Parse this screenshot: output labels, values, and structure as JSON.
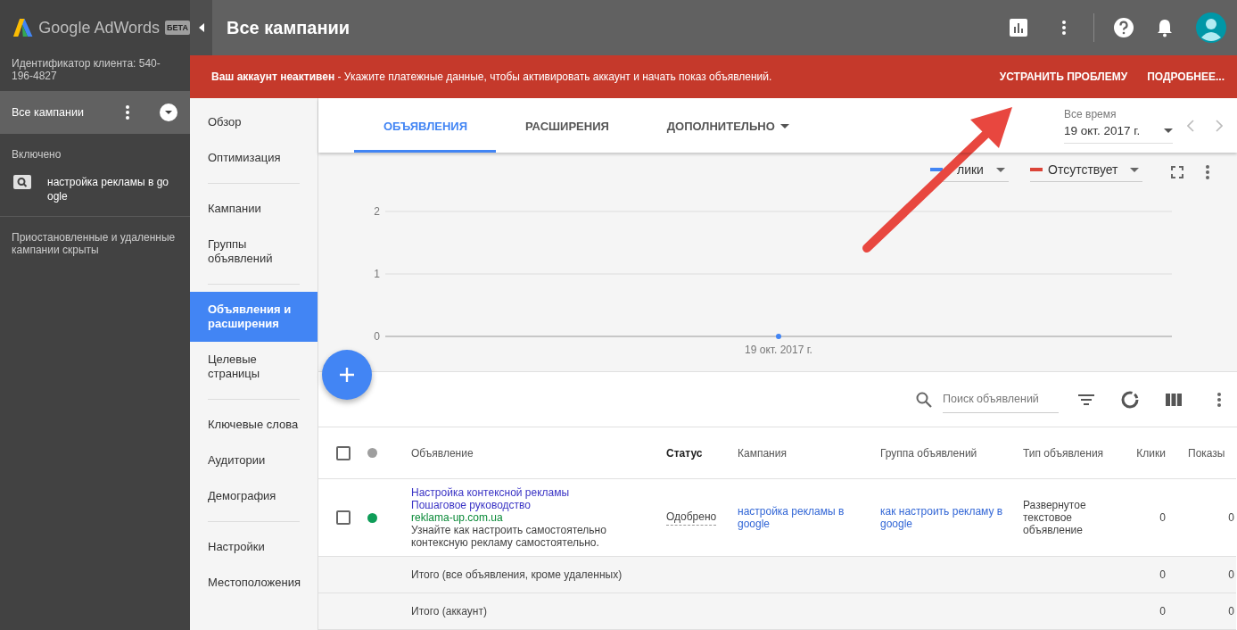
{
  "sidebar": {
    "product": "Google AdWords",
    "badge": "БЕТА",
    "client_id": "Идентификатор клиента: 540-196-4827",
    "current": {
      "label": "Все кампании",
      "selected": true
    },
    "section": "Включено",
    "campaigns": [
      {
        "label": "настройка рекламы в google"
      }
    ],
    "note": "Приостановленные и удаленные кампании скрыты"
  },
  "header": {
    "title": "Все кампании"
  },
  "banner": {
    "message": "**Ваш аккаунт неактивен** - Укажите платежные данные, чтобы активировать аккаунт и начать показ объявлений.",
    "actions": [
      "УСТРАНИТЬ ПРОБЛЕМУ",
      "ПОДРОБНЕЕ..."
    ]
  },
  "nav": {
    "groups": [
      [
        {
          "label": "Обзор",
          "selected": false
        },
        {
          "label": "Оптимизация",
          "selected": false
        }
      ],
      [
        {
          "label": "Кампании",
          "selected": false
        },
        {
          "label": "Группы объявлений",
          "selected": false
        }
      ],
      [
        {
          "label": "Объявления и расширения",
          "selected": true
        },
        {
          "label": "Целевые страницы",
          "selected": false
        }
      ],
      [
        {
          "label": "Ключевые слова",
          "selected": false
        },
        {
          "label": "Аудитории",
          "selected": false
        },
        {
          "label": "Демография",
          "selected": false
        }
      ],
      [
        {
          "label": "Настройки",
          "selected": false
        },
        {
          "label": "Местоположения",
          "selected": false
        }
      ]
    ]
  },
  "tabs": [
    {
      "label": "ОБЪЯВЛЕНИЯ",
      "selected": true,
      "has_menu": false
    },
    {
      "label": "РАСШИРЕНИЯ",
      "selected": false,
      "has_menu": false
    },
    {
      "label": "ДОПОЛНИТЕЛЬНО",
      "selected": false,
      "has_menu": true
    }
  ],
  "date_range": {
    "label": "Все время",
    "value": "19 окт. 2017 г."
  },
  "chart": {
    "metrics": [
      {
        "label": "лики",
        "color": "#4285f4"
      },
      {
        "label": "Отсутствует",
        "color": "#db4437"
      }
    ],
    "chart_data": {
      "type": "line",
      "categories": [
        "19 окт. 2017 г."
      ],
      "series": [
        {
          "color": "#4285f4",
          "marker": "circle",
          "values": [
            0
          ]
        }
      ],
      "ylim": [
        0,
        2
      ],
      "yticks": [
        0,
        1,
        2
      ]
    }
  },
  "table": {
    "search_placeholder": "Поиск объявлений",
    "header": {
      "checked": false,
      "color": "#9e9e9e"
    },
    "columns": [
      {
        "label": "Объявление",
        "sorted": false
      },
      {
        "label": "Статус",
        "sorted": true
      },
      {
        "label": "Кампания",
        "sorted": false
      },
      {
        "label": "Группа объявлений",
        "sorted": false
      },
      {
        "label": "Тип объявления",
        "sorted": false
      },
      {
        "label": "Клики",
        "sorted": false
      },
      {
        "label": "Показы",
        "sorted": false
      }
    ],
    "rows": [
      {
        "checked": false,
        "color": "#0f9d58",
        "headline1": "Настройка контексной рекламы",
        "headline2": "Пошаговое руководство",
        "url": "reklama-up.com.ua",
        "description": "Узнайте как настроить самостоятельно контексную рекламу самостоятельно.",
        "status": "Одобрено",
        "campaign": "настройка рекламы в google",
        "ad_group": "как настроить рекламу в google",
        "ad_type": "Развернутое текстовое объявление",
        "clicks": "0",
        "impressions": "0"
      }
    ],
    "totals": [
      {
        "label": "Итого (все объявления, кроме удаленных)",
        "clicks": "0",
        "impressions": "0"
      },
      {
        "label": "Итого (аккаунт)",
        "clicks": "0",
        "impressions": "0"
      }
    ]
  }
}
